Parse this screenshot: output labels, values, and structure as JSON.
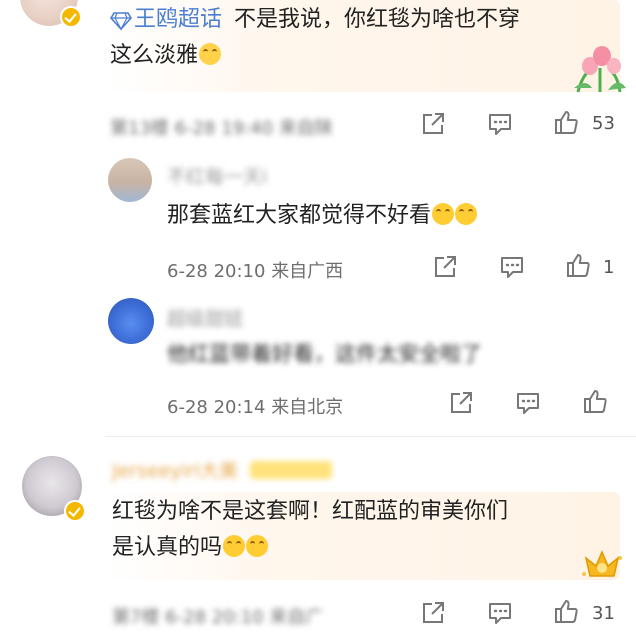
{
  "comments": [
    {
      "user": "王鸥超话",
      "text_line1": "不是我说，你红毯为啥也不穿",
      "text_line2": "这么淡雅",
      "time": "第13楼 6-28 19:40",
      "location": "来自陕",
      "likes": "53"
    },
    {
      "user": "不红每一天i",
      "text": "那套蓝红大家都觉得不好看",
      "time": "6-28 20:10",
      "location": "来自广西",
      "likes": "1"
    },
    {
      "user": "超级甜妞",
      "text": "他红蓝带着好看，这件太安全啦了",
      "time": "6-28 20:14",
      "location": "来自北京",
      "likes": ""
    },
    {
      "user": "Jerseeyiri大美",
      "text_line1": "红毯为啥不是这套啊！红配蓝的审美你们",
      "text_line2": "是认真的吗",
      "time": "第7楼 6-28 20:10",
      "location": "来自广",
      "likes": "31"
    }
  ],
  "icons": {
    "share": "share-icon",
    "comment": "comment-icon",
    "like": "like-icon",
    "diamond": "diamond-icon"
  },
  "colors": {
    "username_blue": "#4c7fd1",
    "highlight_bg": "#fff3e6",
    "verified_gold": "#f5b800"
  }
}
